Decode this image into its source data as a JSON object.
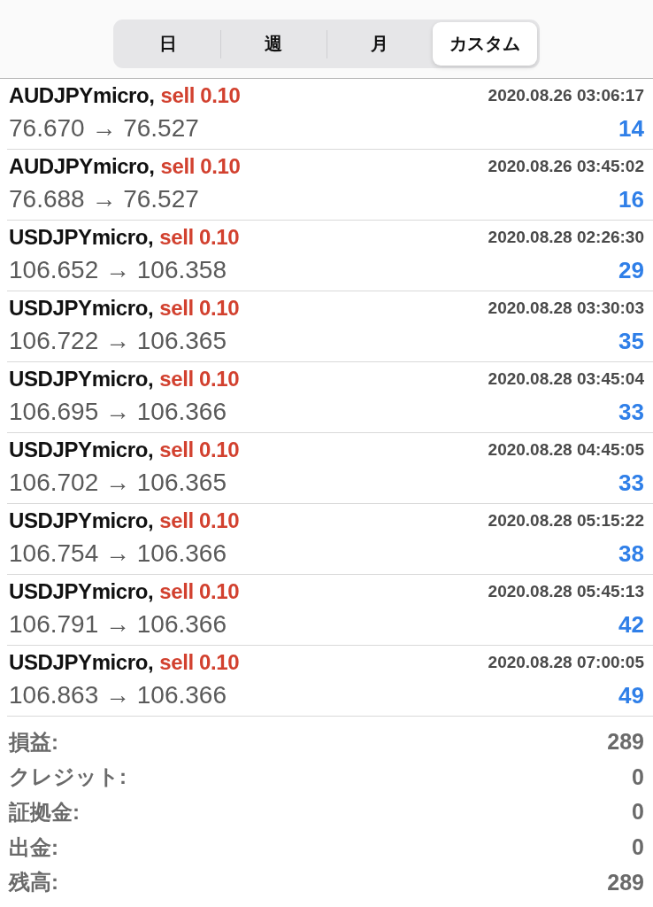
{
  "tabs": [
    {
      "label": "日",
      "selected": false
    },
    {
      "label": "週",
      "selected": false
    },
    {
      "label": "月",
      "selected": false
    },
    {
      "label": "カスタム",
      "selected": true
    }
  ],
  "trades": [
    {
      "symbol": "AUDJPYmicro,",
      "action": "sell 0.10",
      "time": "2020.08.26 03:06:17",
      "prices": "76.670 → 76.527",
      "profit": "14"
    },
    {
      "symbol": "AUDJPYmicro,",
      "action": "sell 0.10",
      "time": "2020.08.26 03:45:02",
      "prices": "76.688 → 76.527",
      "profit": "16"
    },
    {
      "symbol": "USDJPYmicro,",
      "action": "sell 0.10",
      "time": "2020.08.28 02:26:30",
      "prices": "106.652 → 106.358",
      "profit": "29"
    },
    {
      "symbol": "USDJPYmicro,",
      "action": "sell 0.10",
      "time": "2020.08.28 03:30:03",
      "prices": "106.722 → 106.365",
      "profit": "35"
    },
    {
      "symbol": "USDJPYmicro,",
      "action": "sell 0.10",
      "time": "2020.08.28 03:45:04",
      "prices": "106.695 → 106.366",
      "profit": "33"
    },
    {
      "symbol": "USDJPYmicro,",
      "action": "sell 0.10",
      "time": "2020.08.28 04:45:05",
      "prices": "106.702 → 106.365",
      "profit": "33"
    },
    {
      "symbol": "USDJPYmicro,",
      "action": "sell 0.10",
      "time": "2020.08.28 05:15:22",
      "prices": "106.754 → 106.366",
      "profit": "38"
    },
    {
      "symbol": "USDJPYmicro,",
      "action": "sell 0.10",
      "time": "2020.08.28 05:45:13",
      "prices": "106.791 → 106.366",
      "profit": "42"
    },
    {
      "symbol": "USDJPYmicro,",
      "action": "sell 0.10",
      "time": "2020.08.28 07:00:05",
      "prices": "106.863 → 106.366",
      "profit": "49"
    }
  ],
  "summary": [
    {
      "label": "損益:",
      "value": "289"
    },
    {
      "label": "クレジット:",
      "value": "0"
    },
    {
      "label": "証拠金:",
      "value": "0"
    },
    {
      "label": "出金:",
      "value": "0"
    },
    {
      "label": "残高:",
      "value": "289"
    }
  ]
}
